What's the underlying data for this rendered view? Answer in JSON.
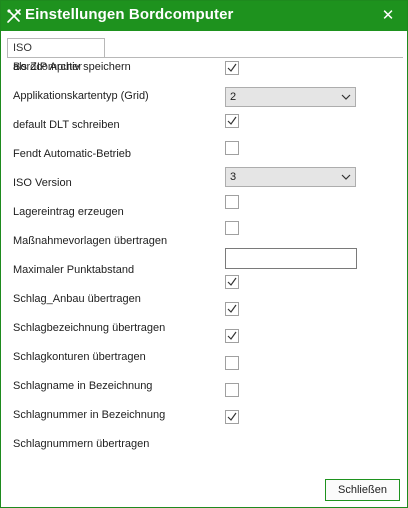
{
  "window": {
    "title": "Einstellungen Bordcomputer",
    "close_glyph": "✕",
    "title_icon": "tractor-tools-icon",
    "accent_color": "#1e921e"
  },
  "tab": {
    "label": "ISO Bordcomputer"
  },
  "settings": [
    {
      "label": "als ZIP Archiv speichern",
      "control": "checkbox",
      "checked": true
    },
    {
      "label": "Applikationskartentyp (Grid)",
      "control": "select",
      "value": "2"
    },
    {
      "label": "default DLT schreiben",
      "control": "checkbox",
      "checked": true
    },
    {
      "label": "Fendt Automatic-Betrieb",
      "control": "checkbox",
      "checked": false
    },
    {
      "label": "ISO Version",
      "control": "select",
      "value": "3"
    },
    {
      "label": "Lagereintrag erzeugen",
      "control": "checkbox",
      "checked": false
    },
    {
      "label": "Maßnahmevorlagen übertragen",
      "control": "checkbox",
      "checked": false
    },
    {
      "label": "Maximaler Punktabstand",
      "control": "text",
      "value": ""
    },
    {
      "label": "Schlag_Anbau übertragen",
      "control": "checkbox",
      "checked": true
    },
    {
      "label": "Schlagbezeichnung übertragen",
      "control": "checkbox",
      "checked": true
    },
    {
      "label": "Schlagkonturen übertragen",
      "control": "checkbox",
      "checked": false
    },
    {
      "label": "Schlagname in Bezeichnung",
      "control": "checkbox",
      "checked": false
    },
    {
      "label": "Schlagnummer in Bezeichnung",
      "control": "checkbox",
      "checked": true
    },
    {
      "label": "Schlagnummern übertragen",
      "control": "none"
    }
  ],
  "footer": {
    "close_label": "Schließen"
  }
}
